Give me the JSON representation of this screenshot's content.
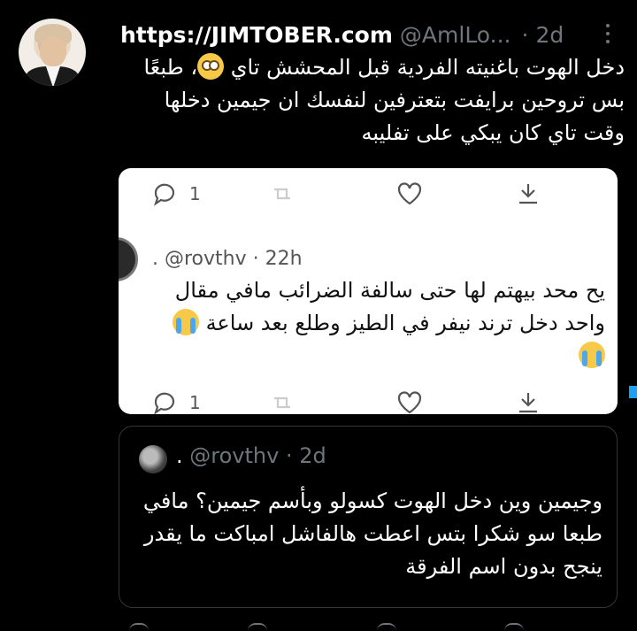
{
  "tweet": {
    "display_name": "https://JIMTOBER.com",
    "handle": "@AmlLo...",
    "separator": "·",
    "time": "2d",
    "text": "دخل الهوت باغنيته الفردية قبل المحشش تاي",
    "text_line2": "طبعًا بس تروحين برايفت بتعترفين لنفسك ان جيمين دخلها وقت تاي كان يبكي على تفليبه",
    "emoji": "face-with-rolling-eyes"
  },
  "screenshot": {
    "top_reply_count": "1",
    "inner_handle": ". @rovthv · 22h",
    "inner_text": "يح محد بيهتم لها حتى سالفة الضرائب مافي مقال واحد دخل ترند نيفر في الطيز وطلع بعد ساعة",
    "bottom_reply_count": "1",
    "emoji": "loudly-crying-face"
  },
  "quote": {
    "handle_prefix": ".",
    "handle": "@rovthv",
    "separator": "·",
    "time": "2d",
    "text": "وجيمين وين دخل الهوت كسولو وبأسم جيمين؟ مافي طبعا سو شكرا بتس اعطت هالفاشل امباكت ما يقدر ينجح بدون اسم الفرقة"
  },
  "colors": {
    "background": "#000000",
    "muted": "#6e767d",
    "accent": "#1da1f2",
    "border": "#333639"
  }
}
